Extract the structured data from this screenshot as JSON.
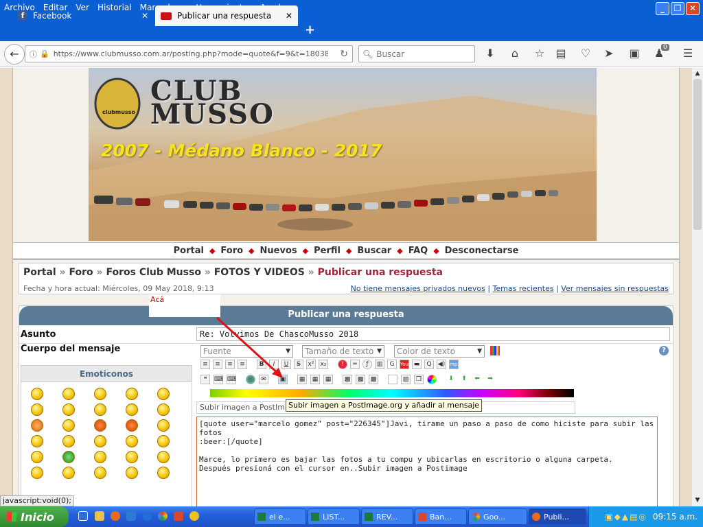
{
  "menu": [
    "Archivo",
    "Editar",
    "Ver",
    "Historial",
    "Marcadores",
    "Herramientas",
    "Ayuda"
  ],
  "window_buttons": {
    "minimize": "_",
    "restore": "❐",
    "close": "✕"
  },
  "tabs": [
    {
      "label": "Facebook",
      "icon": "facebook-icon"
    },
    {
      "label": "Publicar una respuesta",
      "icon": "clubmusso-icon"
    }
  ],
  "new_tab": "+",
  "url": "https://www.clubmusso.com.ar/posting.php?mode=quote&f=9&t=18038&p",
  "search_placeholder": "Buscar",
  "notification_count": "0",
  "banner": {
    "logo_line1": "CLUB",
    "logo_line2": "MUSSO",
    "logo_small": "clubmusso",
    "headline": "2007 - Médano Blanco - 2017"
  },
  "nav_links": [
    "Portal",
    "Foro",
    "Nuevos",
    "Perfil",
    "Buscar",
    "FAQ",
    "Desconectarse"
  ],
  "breadcrumb": {
    "items": [
      "Portal",
      "Foro",
      "Foros Club Musso",
      "FOTOS Y VIDEOS"
    ],
    "current": "Publicar una respuesta",
    "sep": "»"
  },
  "date_line": "Fecha y hora actual: Miércoles, 09 May 2018, 9:13",
  "header_links": [
    "No tiene mensajes privados nuevos",
    "Temas recientes",
    "Ver mensajes sin respuestas"
  ],
  "note": "Acá",
  "panel_title": "Publicar una respuesta",
  "subject_label": "Asunto",
  "subject_value": "Re: Volvimos De ChascoMusso 2018",
  "body_label": "Cuerpo del mensaje",
  "selects": {
    "font": "Fuente",
    "size": "Tamaño de texto",
    "color": "Color de texto"
  },
  "format_buttons": [
    "B",
    "I",
    "U",
    "S",
    "x²",
    "x₂"
  ],
  "emoticons_title": "Emoticonos",
  "helpline": "Subir imagen a PostImage.org y añadir al mensaje",
  "tooltip": "Subir imagen a PostImage.org y añadir al mensaje",
  "message_lines": [
    "[quote user=\"marcelo gomez\" post=\"226345\"]Javi, tirame un paso a paso de como hiciste para subir las fotos",
    ":beer:[/quote]",
    "",
    "Marce, lo primero es bajar las fotos a tu compu y ubicarlas en escritorio o alguna carpeta.",
    "Después presioná con el cursor en..Subir imagen a Postimage"
  ],
  "status_url": "javascript:void(0);",
  "taskbar": {
    "start": "Inicio",
    "buttons": [
      "el e...",
      "LIST...",
      "REV...",
      "Ban...",
      "Goo...",
      "Publi..."
    ],
    "clock": "09:15 a.m."
  }
}
